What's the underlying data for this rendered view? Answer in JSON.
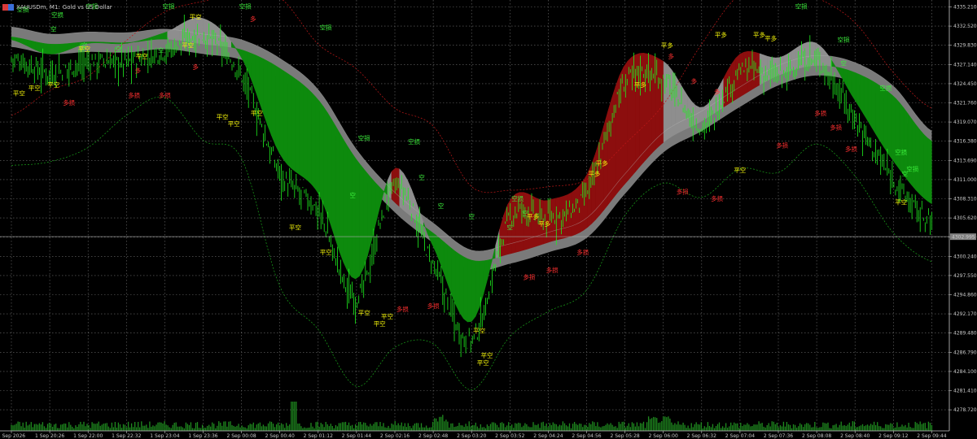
{
  "header": {
    "symbol": "XAUUSDm, M1:",
    "description": "Gold vs US Dollar",
    "flag_colors": [
      "#d93a3a",
      "#3a6fd9"
    ]
  },
  "colors": {
    "background": "#000000",
    "grid": "#6e6e6e",
    "bull_fill": "#0d8a0d",
    "bear_fill": "#8c0e0e",
    "neutral_fill": "#8e8e8e",
    "slow_band": "#7a7a7a",
    "candle": "#1ef01e",
    "label_green": "#3cf03c",
    "label_yellow": "#f2f20a",
    "label_red": "#ff3030",
    "price_box": "#808080",
    "volume": "#1f8a1f"
  },
  "price_axis": {
    "ticks": [
      "4335.210",
      "4332.520",
      "4329.830",
      "4327.140",
      "4324.450",
      "4321.760",
      "4319.070",
      "4316.380",
      "4313.690",
      "4311.000",
      "4308.310",
      "4305.620",
      "4302.930",
      "4300.240",
      "4297.550",
      "4294.860",
      "4292.170",
      "4289.480",
      "4286.790",
      "4284.100",
      "4281.410",
      "4278.720"
    ],
    "current_price": "4302.995"
  },
  "time_axis": {
    "ticks": [
      "1 Sep 2026",
      "1 Sep 20:26",
      "1 Sep 22:00",
      "1 Sep 22:32",
      "1 Sep 23:04",
      "1 Sep 23:36",
      "2 Sep 00:08",
      "2 Sep 00:40",
      "2 Sep 01:12",
      "2 Sep 01:44",
      "2 Sep 02:16",
      "2 Sep 02:48",
      "2 Sep 03:20",
      "2 Sep 03:52",
      "2 Sep 04:24",
      "2 Sep 04:56",
      "2 Sep 05:28",
      "2 Sep 06:00",
      "2 Sep 06:32",
      "2 Sep 07:04",
      "2 Sep 07:36",
      "2 Sep 08:08",
      "2 Sep 08:40",
      "2 Sep 09:12",
      "2 Sep 09:44"
    ]
  },
  "signals": {
    "short_stop": "空损",
    "short": "空",
    "close_short": "平空",
    "close_long": "平多",
    "long": "多",
    "long_stop": "多损"
  },
  "chart_data": {
    "type": "line",
    "title": "XAUUSDm, M1: Gold vs US Dollar",
    "ylim": [
      4277.8,
      4337.5
    ],
    "grid": true,
    "x": [
      "1 Sep 2026",
      "1 Sep 20:26",
      "1 Sep 22:00",
      "1 Sep 22:32",
      "1 Sep 23:04",
      "1 Sep 23:36",
      "2 Sep 00:08",
      "2 Sep 00:40",
      "2 Sep 01:12",
      "2 Sep 01:44",
      "2 Sep 02:16",
      "2 Sep 02:48",
      "2 Sep 03:20",
      "2 Sep 03:52",
      "2 Sep 04:24",
      "2 Sep 04:56",
      "2 Sep 05:28",
      "2 Sep 06:00",
      "2 Sep 06:32",
      "2 Sep 07:04",
      "2 Sep 07:36",
      "2 Sep 08:08",
      "2 Sep 08:40",
      "2 Sep 09:12",
      "2 Sep 09:44"
    ],
    "series": [
      {
        "values": [
          4328.0,
          4326.0,
          4327.5,
          4327.5,
          4329.0,
          4331.0,
          4325.5,
          4312.0,
          4306.5,
          4294.5,
          4310.0,
          4299.0,
          4288.5,
          4305.5,
          4305.5,
          4309.0,
          4324.5,
          4325.0,
          4318.5,
          4326.0,
          4325.5,
          4327.5,
          4319.5,
          4311.0,
          4305.0
        ]
      },
      {
        "values": [
          4331.0,
          4330.0,
          4330.3,
          4330.2,
          4330.7,
          4330.0,
          4329.2,
          4326.6,
          4322.2,
          4313.8,
          4307.8,
          4303.5,
          4299.7,
          4300.6,
          4302.2,
          4304.2,
          4310.4,
          4316.2,
          4319.2,
          4322.6,
          4325.6,
          4327.0,
          4326.0,
          4322.7,
          4316.4
        ]
      },
      {
        "values": [
          4313.0,
          4313.5,
          4315.5,
          4320.0,
          4322.5,
          4316.5,
          4314.0,
          4296.0,
          4290.0,
          4282.0,
          4287.5,
          4288.0,
          4281.5,
          4289.0,
          4292.5,
          4295.5,
          4306.0,
          4310.5,
          4308.5,
          4312.5,
          4312.0,
          4316.0,
          4311.5,
          4303.5,
          4299.5
        ]
      },
      {
        "values": [
          4320.0,
          4323.5,
          4325.5,
          4330.5,
          4334.5,
          4336.0,
          4337.0,
          4336.5,
          4330.0,
          4326.5,
          4321.0,
          4318.5,
          4310.0,
          4309.5,
          4310.0,
          4311.0,
          4316.0,
          4321.5,
          4330.0,
          4337.0,
          4338.0,
          4336.5,
          4333.0,
          4326.0,
          4321.0
        ]
      }
    ]
  }
}
